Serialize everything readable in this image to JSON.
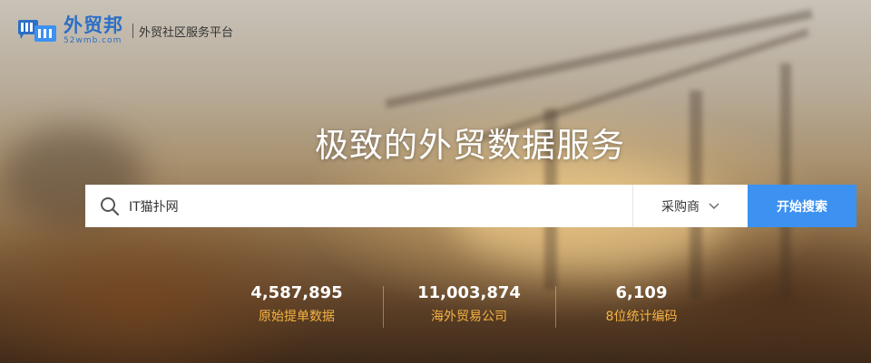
{
  "header": {
    "logo_cn": "外贸邦",
    "logo_domain": "52wmb.com",
    "tagline": "外贸社区服务平台"
  },
  "hero": {
    "title": "极致的外贸数据服务"
  },
  "search": {
    "query": "IT猫扑网",
    "type_selected": "采购商",
    "button_label": "开始搜索"
  },
  "stats": [
    {
      "value": "4,587,895",
      "label": "原始提单数据"
    },
    {
      "value": "11,003,874",
      "label": "海外贸易公司"
    },
    {
      "value": "6,109",
      "label": "8位统计编码"
    }
  ],
  "colors": {
    "brand_blue": "#2b6fc6",
    "button_blue": "#3c91f1",
    "stat_label_orange": "#f5b342"
  }
}
